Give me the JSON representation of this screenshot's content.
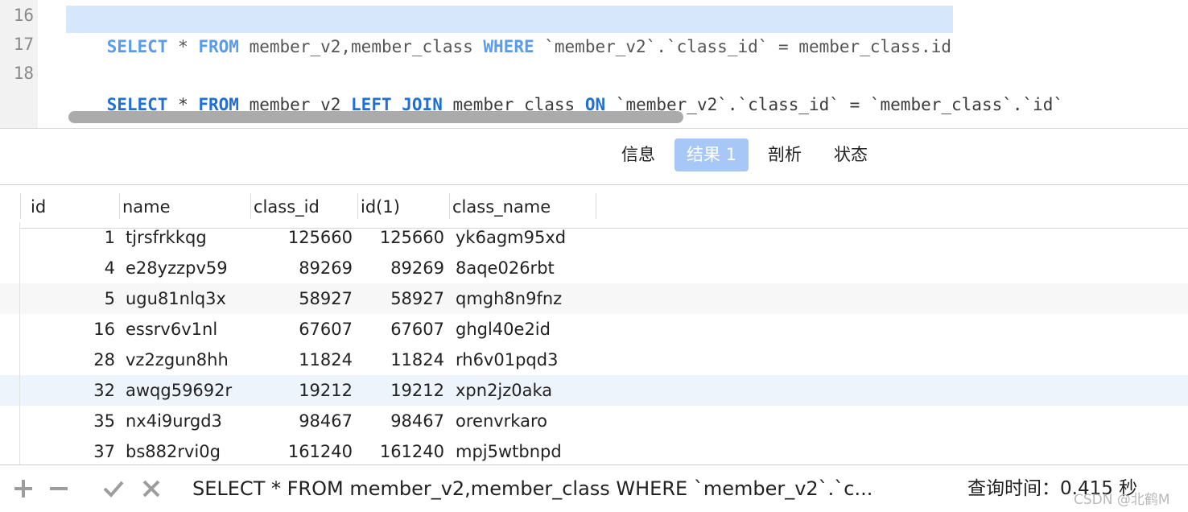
{
  "editor": {
    "line_numbers": [
      "16",
      "17",
      "18"
    ],
    "line16": {
      "parts": [
        "SELECT",
        " * ",
        "FROM",
        " member_v2,member_class ",
        "WHERE",
        " `member_v2`.`class_id` = member_class.id"
      ]
    },
    "line18": {
      "parts": [
        "SELECT",
        " * ",
        "FROM",
        " member_v2 ",
        "LEFT",
        " ",
        "JOIN",
        " member_class ",
        "ON",
        " `member_v2`.`class_id` = `member_class`.`id`"
      ]
    }
  },
  "tabs": [
    {
      "label": "信息",
      "active": false
    },
    {
      "label": "结果 1",
      "active": true
    },
    {
      "label": "剖析",
      "active": false
    },
    {
      "label": "状态",
      "active": false
    }
  ],
  "grid": {
    "columns": [
      "id",
      "name",
      "class_id",
      "id(1)",
      "class_name"
    ],
    "rows": [
      [
        "1",
        "tjrsfrkkqg",
        "125660",
        "125660",
        "yk6agm95xd"
      ],
      [
        "4",
        "e28yzzpv59",
        "89269",
        "89269",
        "8aqe026rbt"
      ],
      [
        "5",
        "ugu81nlq3x",
        "58927",
        "58927",
        "qmgh8n9fnz"
      ],
      [
        "16",
        "essrv6v1nl",
        "67607",
        "67607",
        "ghgl40e2id"
      ],
      [
        "28",
        "vz2zgun8hh",
        "11824",
        "11824",
        "rh6v01pqd3"
      ],
      [
        "32",
        "awqg59692r",
        "19212",
        "19212",
        "xpn2jz0aka"
      ],
      [
        "35",
        "nx4i9urgd3",
        "98467",
        "98467",
        "orenvrkaro"
      ],
      [
        "37",
        "bs882rvi0g",
        "161240",
        "161240",
        "mpj5wtbnpd"
      ]
    ]
  },
  "statusbar": {
    "icons": [
      "plus-icon",
      "minus-icon",
      "check-icon",
      "cross-icon"
    ],
    "sql": "SELECT * FROM member_v2,member_class WHERE `member_v2`.`c...",
    "query_time": "查询时间：0.415 秒"
  },
  "watermark": "CSDN @北鹤M",
  "colors": {
    "keyword": "#1f6fd6",
    "selection": "#d6e7fb",
    "active_tab": "#a7c8f6",
    "scrollbar_thumb": "#ababab"
  }
}
